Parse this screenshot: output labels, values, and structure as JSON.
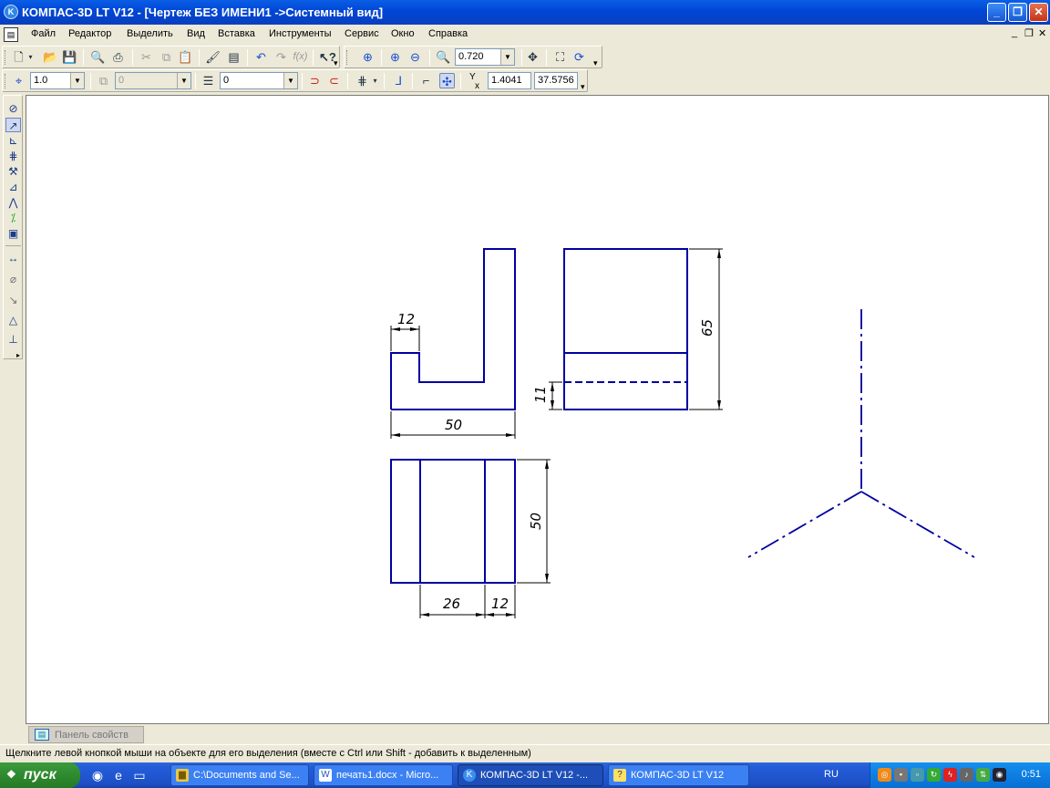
{
  "window": {
    "title": "КОМПАС-3D LT V12 - [Чертеж БЕЗ ИМЕНИ1 ->Системный вид]",
    "icon": "kompas-logo-icon",
    "controls": {
      "minimize": "_",
      "restore": "❐",
      "close": "✕"
    }
  },
  "menu": {
    "items": [
      "Файл",
      "Редактор",
      "Выделить",
      "Вид",
      "Вставка",
      "Инструменты",
      "Сервис",
      "Окно",
      "Справка"
    ],
    "mdi_controls": {
      "minimize": "_",
      "restore": "❐",
      "close": "✕"
    }
  },
  "toolbar_standard": {
    "zoom_value": "0.720"
  },
  "toolbar_current_state": {
    "step_value": "1.0",
    "layer_value": "0",
    "style_value": "0",
    "coord_label_y": "Y",
    "coord_label_x": "x",
    "coord_x": "1.4041",
    "coord_y": "37.5756"
  },
  "drawing": {
    "line_color": "#0000a0",
    "dimensions": {
      "front_width": "50",
      "front_step": "12",
      "side_height": "65",
      "side_hidden": "11",
      "top_depth": "50",
      "top_middle": "26",
      "top_right": "12"
    }
  },
  "property_panel": {
    "tab_label": "Панель свойств"
  },
  "status": {
    "text": "Щелкните левой кнопкой мыши на объекте для его выделения (вместе с Ctrl или Shift - добавить к выделенным)"
  },
  "taskbar": {
    "start_label": "пуск",
    "tasks": [
      {
        "label": "C:\\Documents and Se...",
        "icon": "folder-icon"
      },
      {
        "label": "печать1.docx - Micro...",
        "icon": "word-icon"
      },
      {
        "label": "КОМПАС-3D LT V12 -...",
        "icon": "kompas-icon"
      },
      {
        "label": "КОМПАС-3D LT V12",
        "icon": "help-icon"
      }
    ],
    "language": "RU",
    "clock": "0:51"
  }
}
